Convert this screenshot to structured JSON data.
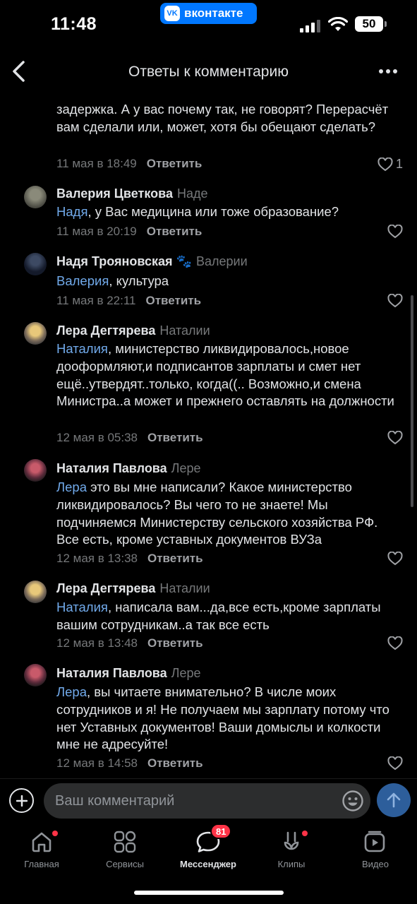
{
  "status_bar": {
    "time": "11:48",
    "app_pill": "вконтакте",
    "battery": "50"
  },
  "header": {
    "title": "Ответы к комментарию"
  },
  "top_partial": {
    "text": "задержка. А у вас почему так, не говорят? Перерасчёт вам сделали или, может, хотя бы обещают сделать?",
    "date": "11 мая в 18:49",
    "reply": "Ответить",
    "likes": "1"
  },
  "comments": [
    {
      "name": "Валерия Цветкова",
      "reply_to": "Наде",
      "mention": "Надя",
      "text": ", у Вас медицина или тоже образование?",
      "date": "11 мая в 20:19",
      "reply": "Ответить"
    },
    {
      "name": "Надя Трояновская",
      "emoji": "🐾",
      "reply_to": "Валерии",
      "mention": "Валерия",
      "text": ", культура",
      "date": "11 мая в 22:11",
      "reply": "Ответить"
    },
    {
      "name": "Лера Дегтярева",
      "reply_to": "Наталии",
      "mention": "Наталия",
      "text": ", министерство ликвидировалось,новое дооформляют,и подписантов зарплаты и смет нет ещё..утвердят..только, когда((.. Возможно,и смена Министра..а может и прежнего оставлять на должности",
      "date": "12 мая в 05:38",
      "reply": "Ответить"
    },
    {
      "name": "Наталия Павлова",
      "reply_to": "Лере",
      "mention": "Лера",
      "text": " это вы мне написали? Какое министерство ликвидировалось? Вы чего то не знаете! Мы подчиняемся Министерству сельского хозяйства РФ. Все есть, кроме уставных документов ВУЗа",
      "date": "12 мая в 13:38",
      "reply": "Ответить"
    },
    {
      "name": "Лера Дегтярева",
      "reply_to": "Наталии",
      "mention": "Наталия",
      "text": ", написала вам...да,все есть,кроме зарплаты вашим сотрудникам..а так все есть",
      "date": "12 мая в 13:48",
      "reply": "Ответить"
    },
    {
      "name": "Наталия Павлова",
      "reply_to": "Лере",
      "mention": "Лера",
      "text": ", вы читаете внимательно? В числе моих сотрудников и я! Не получаем мы зарплату потому что нет Уставных документов! Ваши домыслы и колкости мне не адресуйте!",
      "date": "12 мая в 14:58",
      "reply": "Ответить"
    }
  ],
  "input": {
    "placeholder": "Ваш комментарий"
  },
  "tabs": [
    {
      "label": "Главная",
      "icon": "home-icon",
      "dot": true
    },
    {
      "label": "Сервисы",
      "icon": "services-icon"
    },
    {
      "label": "Мессенджер",
      "icon": "messenger-icon",
      "badge": "81",
      "active": true
    },
    {
      "label": "Клипы",
      "icon": "clips-icon",
      "dot": true
    },
    {
      "label": "Видео",
      "icon": "video-icon"
    }
  ],
  "colors": {
    "accent": "#0077ff",
    "mention": "#71aaeb",
    "badge": "#ff3347",
    "background": "#000000"
  }
}
